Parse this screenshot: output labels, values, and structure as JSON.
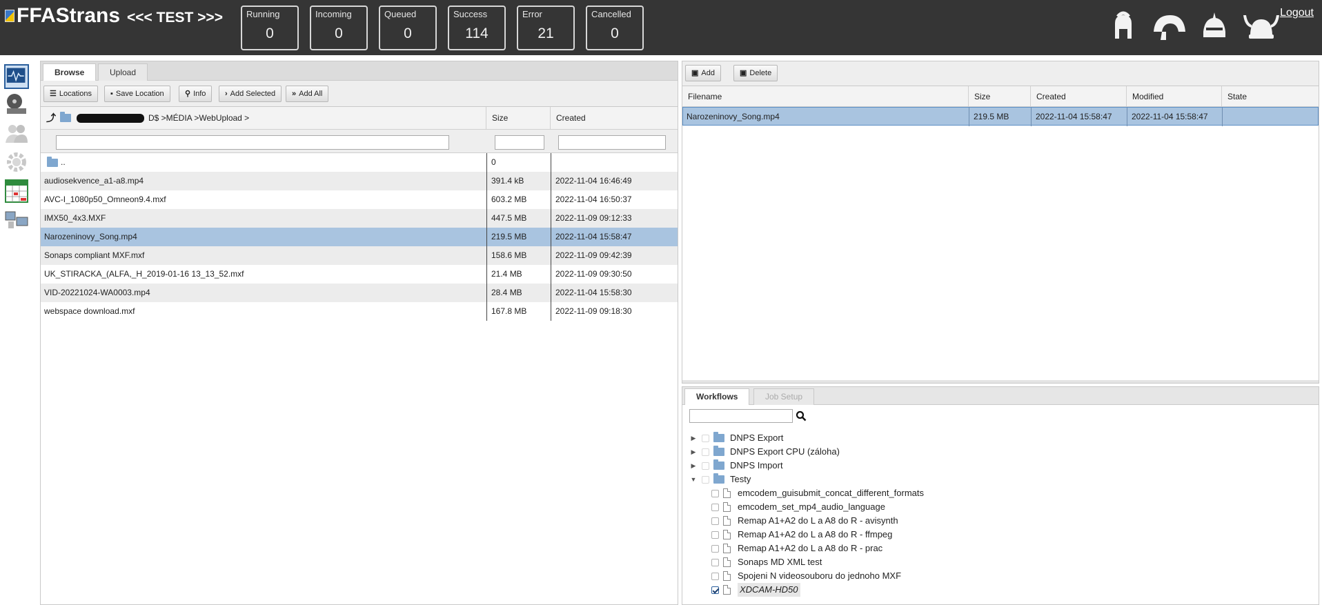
{
  "header": {
    "app_name": "FFAStrans",
    "environment": "<<< TEST >>>",
    "logout_label": "Logout",
    "counters": [
      {
        "label": "Running",
        "value": "0"
      },
      {
        "label": "Incoming",
        "value": "0"
      },
      {
        "label": "Queued",
        "value": "0"
      },
      {
        "label": "Success",
        "value": "114"
      },
      {
        "label": "Error",
        "value": "21"
      },
      {
        "label": "Cancelled",
        "value": "0"
      }
    ],
    "helmet_icons": [
      "spartan-helmet-icon",
      "roman-helmet-icon",
      "knight-helmet-icon",
      "viking-helmet-icon"
    ]
  },
  "sidebar": {
    "icons": [
      "monitor-icon",
      "film-reel-icon",
      "users-icon",
      "gear-icon",
      "calendar-icon",
      "network-computers-icon"
    ]
  },
  "browser": {
    "tabs": [
      "Browse",
      "Upload"
    ],
    "toolbar": {
      "locations": "Locations",
      "save_location": "Save Location",
      "info": "Info",
      "add_selected": "Add Selected",
      "add_all": "Add All"
    },
    "path_prefix": "D$ >MÉDIA >WebUpload >",
    "columns": [
      "Size",
      "Created"
    ],
    "parent_name": "..",
    "parent_size": "0",
    "files": [
      {
        "name": "audiosekvence_a1-a8.mp4",
        "size": "391.4 kB",
        "created": "2022-11-04 16:46:49"
      },
      {
        "name": "AVC-I_1080p50_Omneon9.4.mxf",
        "size": "603.2 MB",
        "created": "2022-11-04 16:50:37"
      },
      {
        "name": "IMX50_4x3.MXF",
        "size": "447.5 MB",
        "created": "2022-11-09 09:12:33"
      },
      {
        "name": "Narozeninovy_Song.mp4",
        "size": "219.5 MB",
        "created": "2022-11-04 15:58:47"
      },
      {
        "name": "Sonaps compliant MXF.mxf",
        "size": "158.6 MB",
        "created": "2022-11-09 09:42:39"
      },
      {
        "name": "UK_STIRACKA_(ALFA,_H_2019-01-16 13_13_52.mxf",
        "size": "21.4 MB",
        "created": "2022-11-09 09:30:50"
      },
      {
        "name": "VID-20221024-WA0003.mp4",
        "size": "28.4 MB",
        "created": "2022-11-04 15:58:30"
      },
      {
        "name": "webspace download.mxf",
        "size": "167.8 MB",
        "created": "2022-11-09 09:18:30"
      }
    ]
  },
  "selection": {
    "toolbar": {
      "add": "Add",
      "delete": "Delete"
    },
    "columns": [
      "Filename",
      "Size",
      "Created",
      "Modified",
      "State"
    ],
    "rows": [
      {
        "filename": "Narozeninovy_Song.mp4",
        "size": "219.5 MB",
        "created": "2022-11-04 15:58:47",
        "modified": "2022-11-04 15:58:47",
        "state": ""
      }
    ]
  },
  "workflows": {
    "tabs": [
      "Workflows",
      "Job Setup"
    ],
    "search_placeholder": "",
    "folders": [
      "DNPS Export",
      "DNPS Export CPU (záloha)",
      "DNPS Import",
      "Testy"
    ],
    "items": [
      "emcodem_guisubmit_concat_different_formats",
      "emcodem_set_mp4_audio_language",
      "Remap A1+A2 do L a A8 do R - avisynth",
      "Remap A1+A2 do L a A8 do R - ffmpeg",
      "Remap A1+A2 do L a A8 do R - prac",
      "Sonaps MD XML test",
      "Spojeni N videosouboru do jednoho MXF",
      "XDCAM-HD50"
    ]
  }
}
